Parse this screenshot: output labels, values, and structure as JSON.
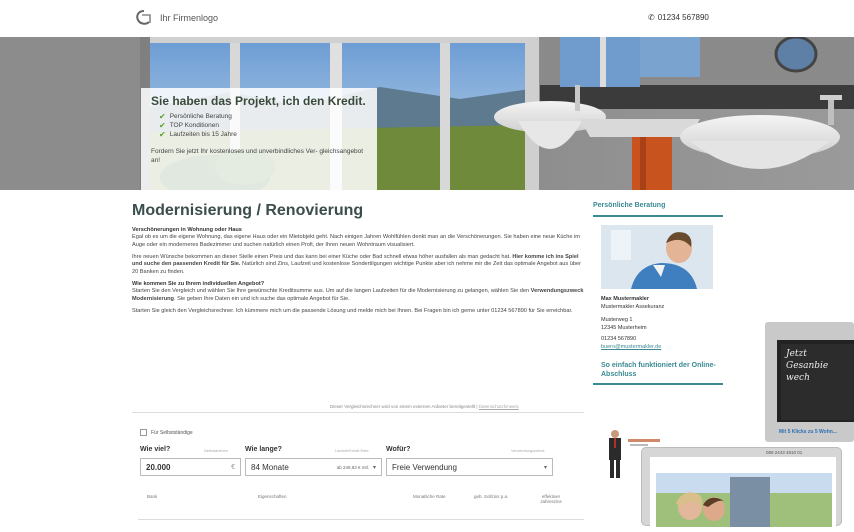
{
  "header": {
    "logo_text": "Ihr Firmenlogo",
    "phone": "01234 567890"
  },
  "hero": {
    "headline": "Sie haben das Projekt, ich den Kredit.",
    "bullets": [
      "Persönliche Beratung",
      "TOP Konditionen",
      "Laufzeiten bis 15 Jahre"
    ],
    "text": "Fordern Sie jetzt Ihr kostenloses und unverbindliches Ver- gleichsangebot an!"
  },
  "main": {
    "title": "Modernisierung / Renovierung",
    "section1_title": "Verschönerungen in Wohnung oder Haus",
    "section1_text": "Egal ob es um die eigene Wohnung, das eigene Haus oder ein Mietobjekt geht. Nach einigen Jahren Wohlfühlen denkt man an die Verschönerungen. Sie haben eine neue Küche im Auge oder ein moderneres Badezimmer und suchen natürlich einen Profi, der Ihren neuen Wohntraum visualisiert.",
    "section2_text_a": "Ihre neuen Wünsche bekommen an dieser Stelle einen Preis und das kann bei einer Küche oder Bad schnell etwas höher ausfallen als man gedacht hat. ",
    "section2_bold": "Hier komme ich ins Spiel und suche den passenden Kredit für Sie.",
    "section2_text_b": " Natürlich sind Zins, Laufzeit und kostenlose Sondertilgungen wichtige Punkte aber ich nehme mir die Zeit das optimale Angebot aus über 20 Banken zu finden.",
    "section3_title": "Wie kommen Sie zu Ihrem individuellen Angebot?",
    "section3_text_a": "Starten Sie den Vergleich und wählen Sie Ihre gewünschte Kreditsumme aus. Um auf die langen Laufzeiten für die Modernisierung zu gelangen, wählen Sie den ",
    "section3_bold": "Verwendungszweck Modernisierung",
    "section3_text_b": ". Sie geben Ihre Daten ein und ich suche das optimale Angebot für Sie.",
    "section4_text": "Starten Sie gleich den Vergleichsrechner. Ich kümmere mich um die passende Lösung und melde mich bei Ihnen. Bei Fragen bin ich gerne unter 01234 567890 für Sie erreichbar."
  },
  "calculator": {
    "note": "Dieser Vergleichsrechner wird von einem externen Anbieter bereitgestellt | ",
    "note_link": "Datenschutzhinweis",
    "self_employed": "Für Selbstständige",
    "amount_label": "Wie viel?",
    "amount_sub": "Nettodarlehen",
    "amount_value": "20.000",
    "amount_unit": "€",
    "duration_label": "Wie lange?",
    "duration_sub": "Laufzeit/Kredit-Rate",
    "duration_value": "84 Monate",
    "duration_rate": "ab 249,83 € mtl.",
    "purpose_label": "Wofür?",
    "purpose_sub": "Verwendungszweck",
    "purpose_value": "Freie Verwendung",
    "col_bank": "Bank",
    "col_features": "Eigenschaften",
    "col_rate": "Monatliche Rate",
    "col_interest": "geb. Sollzins p.a.",
    "col_effective": "effektiver Jahreszins"
  },
  "sidebar": {
    "advice_title": "Persönliche Beratung",
    "name": "Max Mustermakler",
    "company": "Mustermakler Assekuranz",
    "street": "Musterweg 1",
    "city": "12345 Musterheim",
    "phone": "01234 567890",
    "email": "buero@mustermakler.de",
    "online_title": "So einfach funktioniert der Online-Abschluss"
  },
  "promo": {
    "board_text": "Jetzt Gesanbie wech",
    "link_text": "Mit 5 Klicks zu 5 Wohn...",
    "tablet_phone": "089 2443 4810 01"
  },
  "colors": {
    "accent": "#3a8a94",
    "check": "#5aa02c",
    "heading": "#3b4d4d"
  }
}
